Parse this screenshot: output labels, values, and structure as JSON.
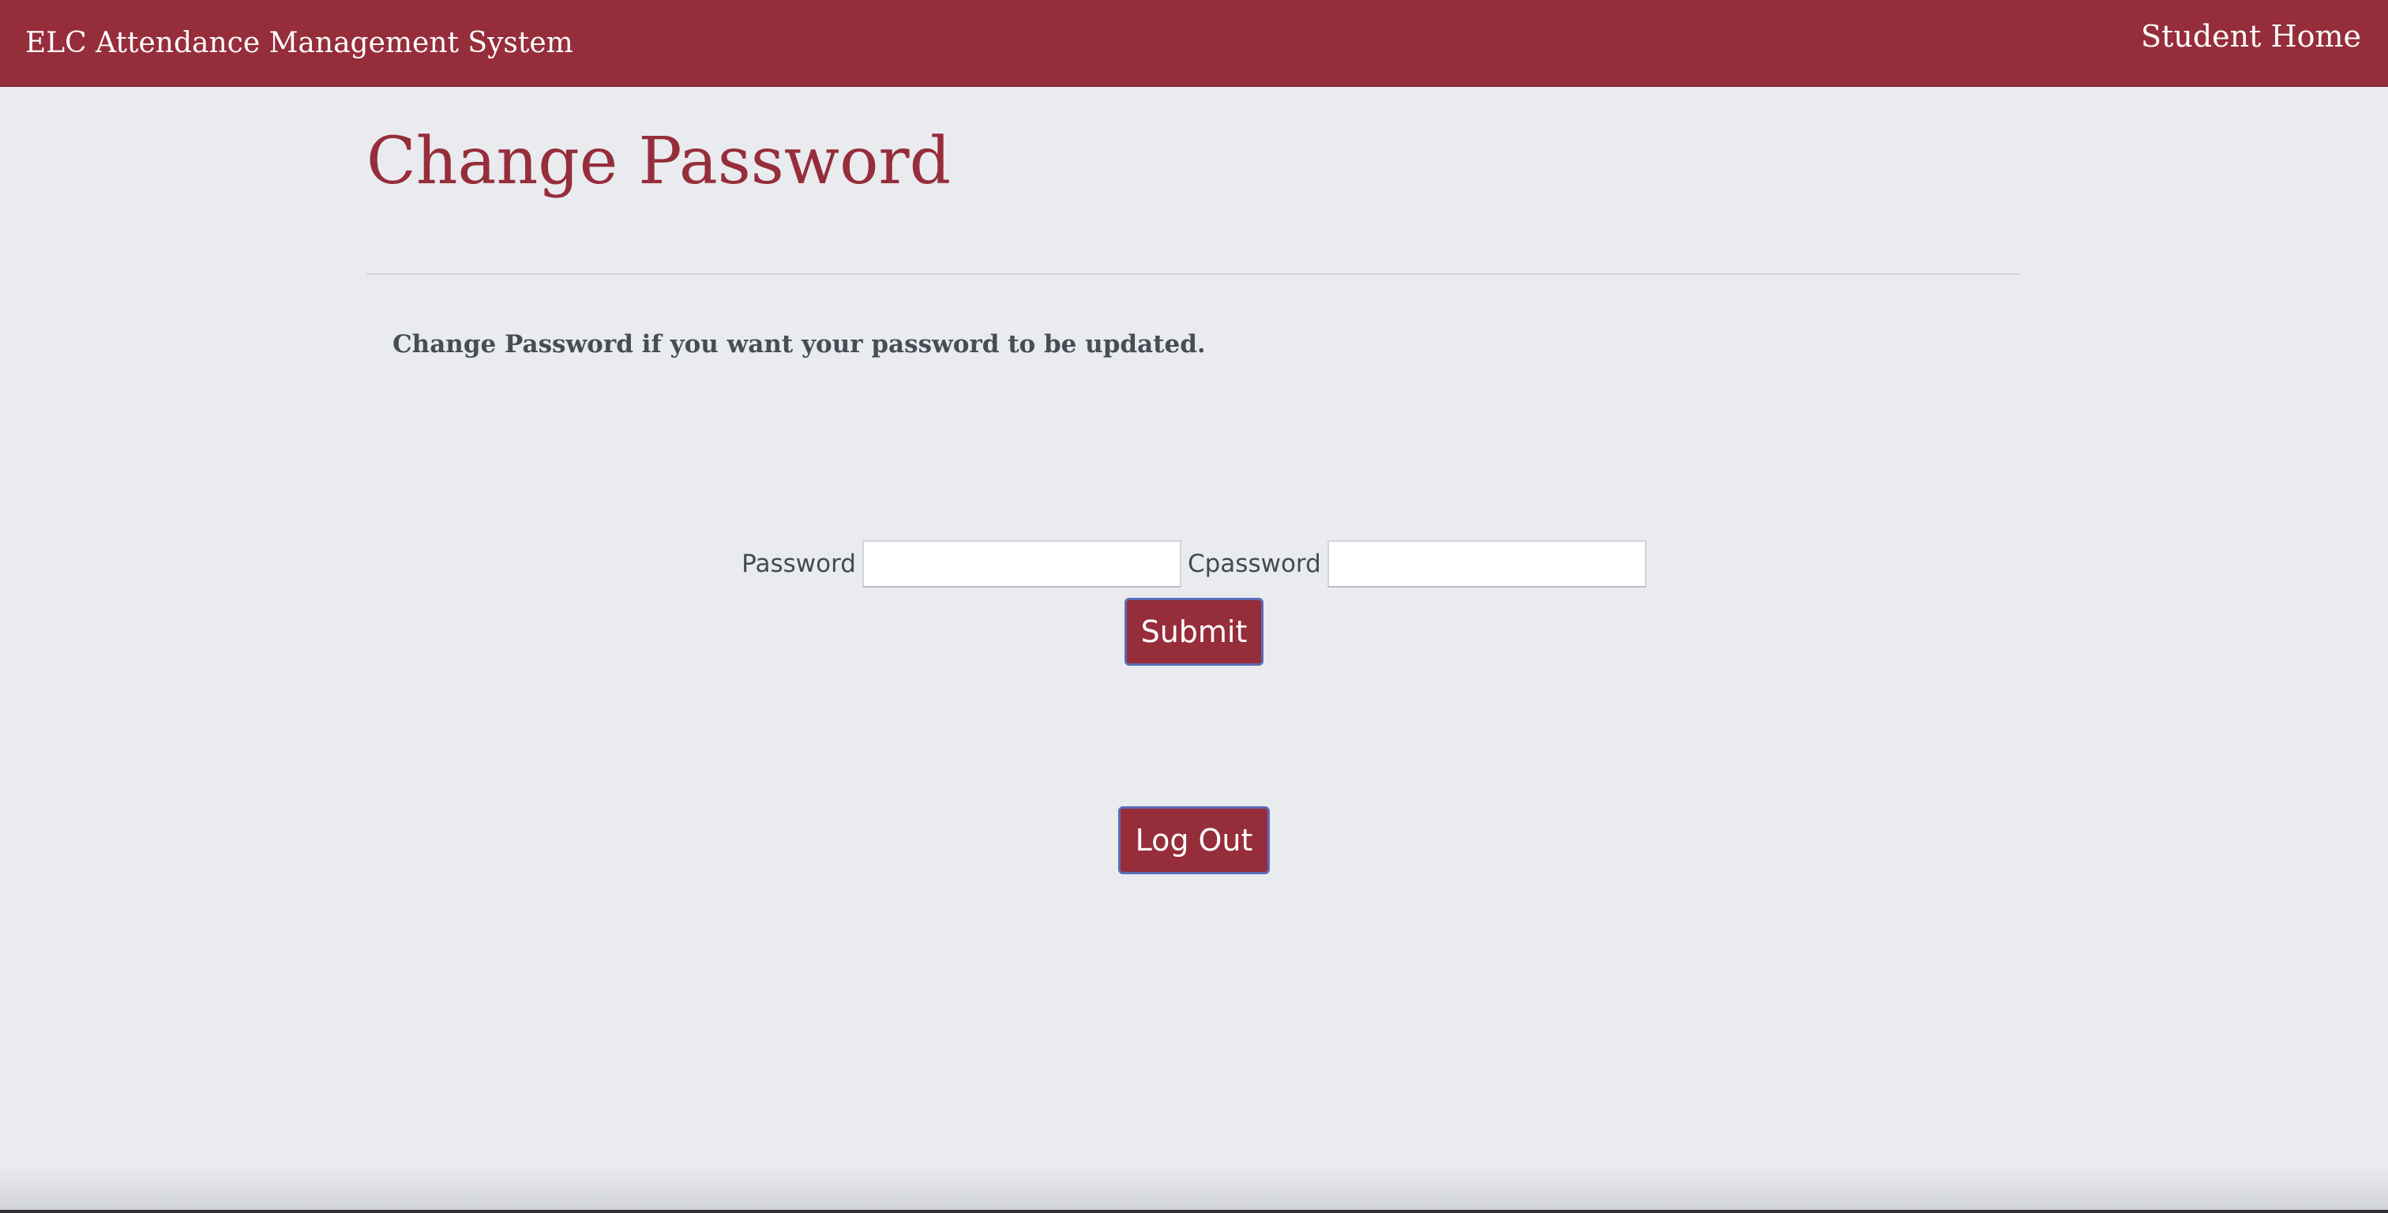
{
  "navbar": {
    "brand": "ELC Attendance Management System",
    "home_link": "Student Home"
  },
  "page": {
    "title": "Change Password",
    "subtitle": "Change Password if you want your password to be updated."
  },
  "form": {
    "password_label": "Password",
    "password_value": "",
    "cpassword_label": "Cpassword",
    "cpassword_value": "",
    "submit_label": "Submit"
  },
  "logout_label": "Log Out",
  "colors": {
    "brand": "#962d3b",
    "background": "#e9ebef",
    "text": "#474d55",
    "button_border": "#5b6bb5"
  }
}
